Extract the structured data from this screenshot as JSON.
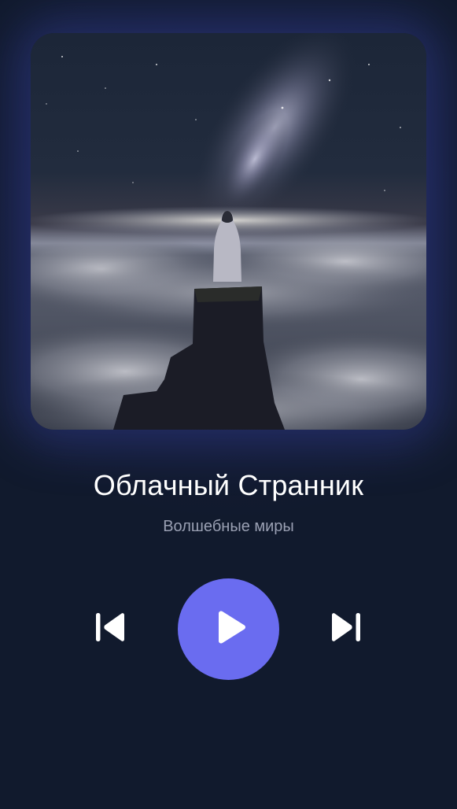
{
  "track": {
    "title": "Облачный Странник",
    "artist": "Волшебные миры"
  },
  "artwork": {
    "subject": "figure-on-cliff-above-clouds-night-sky"
  },
  "controls": {
    "previous_icon": "skip-previous-icon",
    "play_icon": "play-icon",
    "next_icon": "skip-next-icon"
  },
  "colors": {
    "background": "#111a2d",
    "accent": "#6a6cf0",
    "title": "#ffffff",
    "subtitle": "#9aa0b3"
  }
}
